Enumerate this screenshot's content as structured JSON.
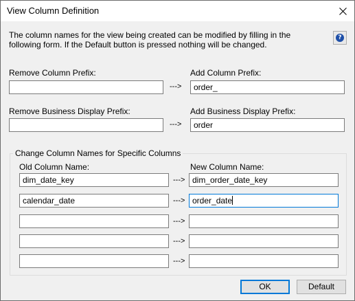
{
  "window": {
    "title": "View Column Definition"
  },
  "intro_text": "The column names for the view being created can be modified by filling in the following form. If the Default button is pressed nothing will be changed.",
  "prefix": {
    "remove_column_label": "Remove Column Prefix:",
    "remove_column_value": "",
    "add_column_label": "Add Column Prefix:",
    "add_column_value": "order_",
    "remove_business_label": "Remove Business Display Prefix:",
    "remove_business_value": "",
    "add_business_label": "Add Business Display Prefix:",
    "add_business_value": "order",
    "arrow": "--->"
  },
  "specific": {
    "group_title": "Change Column Names for Specific Columns",
    "old_header": "Old Column Name:",
    "new_header": "New Column Name:",
    "arrow": "--->",
    "rows": [
      {
        "old": "dim_date_key",
        "new": "dim_order_date_key"
      },
      {
        "old": "calendar_date",
        "new": "order_date"
      },
      {
        "old": "",
        "new": ""
      },
      {
        "old": "",
        "new": ""
      },
      {
        "old": "",
        "new": ""
      }
    ]
  },
  "buttons": {
    "ok": "OK",
    "default": "Default"
  },
  "icons": {
    "close": "close-icon",
    "help": "help-icon",
    "help_color": "#1e4fa8"
  }
}
